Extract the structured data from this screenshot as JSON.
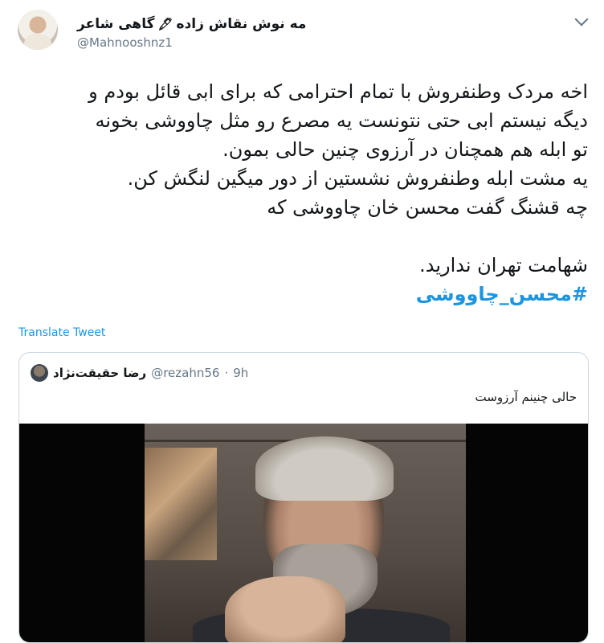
{
  "author": {
    "display_name": "مه نوش نقاش زاده",
    "pen_glyph": "🖋",
    "name_suffix": "گاهی شاعر",
    "handle": "@Mahnooshnz1"
  },
  "tweet": {
    "lines": [
      "اخه مردک وطنفروش با تمام احترامی که برای ابی قائل بودم و",
      "دیگه نیستم ابی حتی نتونست یه مصرع رو مثل چاووشی بخونه",
      "تو ابله هم همچنان در آرزوی چنین حالی بمون.",
      "یه مشت ابله وطنفروش نشستین از دور میگین لنگش کن.",
      "چه قشنگ گفت محسن خان چاووشی که",
      "شهامت تهران ندارید."
    ],
    "hashtag": "#محسن_چاووشی",
    "translate_label": "Translate Tweet"
  },
  "quote": {
    "name": "رضا حقیقت‌نژاد",
    "handle": "@rezahn56",
    "separator": "·",
    "time": "9h",
    "text": "حالی چنینم آرزوست"
  },
  "colors": {
    "link": "#1b95e0",
    "muted": "#657786",
    "border": "#ccd6dd"
  },
  "icons": {
    "menu": "chevron-down-icon"
  }
}
